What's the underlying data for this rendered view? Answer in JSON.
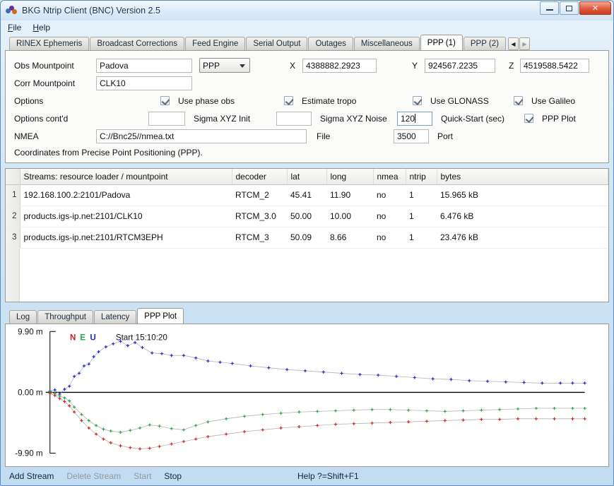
{
  "window": {
    "title": "BKG Ntrip Client (BNC) Version 2.5",
    "icon": "bnc-app-icon",
    "buttons": {
      "minimize": "minimize-icon",
      "maximize": "maximize-icon",
      "close": "✕"
    }
  },
  "menubar": {
    "items": [
      {
        "label": "File"
      },
      {
        "label": "Help"
      }
    ]
  },
  "top_tabs": {
    "items": [
      {
        "label": "RINEX Ephemeris",
        "active": false
      },
      {
        "label": "Broadcast Corrections",
        "active": false
      },
      {
        "label": "Feed Engine",
        "active": false
      },
      {
        "label": "Serial Output",
        "active": false
      },
      {
        "label": "Outages",
        "active": false
      },
      {
        "label": "Miscellaneous",
        "active": false
      },
      {
        "label": "PPP (1)",
        "active": true
      },
      {
        "label": "PPP (2)",
        "active": false
      }
    ],
    "scroll_left": "◀",
    "scroll_right": "▶"
  },
  "ppp_form": {
    "obs_mountpoint_label": "Obs Mountpoint",
    "obs_mountpoint_value": "Padova",
    "mode_combo_value": "PPP",
    "x_label": "X",
    "x_value": "4388882.2923",
    "y_label": "Y",
    "y_value": "924567.2235",
    "z_label": "Z",
    "z_value": "4519588.5422",
    "corr_mountpoint_label": "Corr Mountpoint",
    "corr_mountpoint_value": "CLK10",
    "options_label": "Options",
    "use_phase_obs_label": "Use phase obs",
    "use_phase_obs_checked": true,
    "estimate_tropo_label": "Estimate tropo",
    "estimate_tropo_checked": true,
    "use_glonass_label": "Use GLONASS",
    "use_glonass_checked": true,
    "use_galileo_label": "Use Galileo",
    "use_galileo_checked": true,
    "options_contd_label": "Options cont'd",
    "sigma_xyz_init_label": "Sigma XYZ Init",
    "sigma_xyz_init_value": "",
    "sigma_xyz_noise_label": "Sigma XYZ Noise",
    "sigma_xyz_noise_value": "120",
    "sigma_xyz_noise_focused": true,
    "quick_start_label": "Quick-Start (sec)",
    "ppp_plot_label": "PPP Plot",
    "ppp_plot_checked": true,
    "nmea_label": "NMEA",
    "nmea_value": "C://Bnc25//nmea.txt",
    "file_label": "File",
    "port_value": "3500",
    "port_label": "Port",
    "note": "Coordinates from Precise Point Positioning (PPP)."
  },
  "streams_table": {
    "columns": [
      {
        "key": "gutter",
        "label": ""
      },
      {
        "key": "resource",
        "label": "Streams:   resource loader / mountpoint"
      },
      {
        "key": "decoder",
        "label": "decoder"
      },
      {
        "key": "lat",
        "label": "lat"
      },
      {
        "key": "long",
        "label": "long"
      },
      {
        "key": "nmea",
        "label": "nmea"
      },
      {
        "key": "ntrip",
        "label": "ntrip"
      },
      {
        "key": "bytes",
        "label": "bytes"
      }
    ],
    "rows": [
      {
        "n": "1",
        "resource": "192.168.100.2:2101/Padova",
        "decoder": "RTCM_2",
        "lat": "45.41",
        "long": "11.90",
        "nmea": "no",
        "ntrip": "1",
        "bytes": "15.965 kB"
      },
      {
        "n": "2",
        "resource": "products.igs-ip.net:2101/CLK10",
        "decoder": "RTCM_3.0",
        "lat": "50.00",
        "long": "10.00",
        "nmea": "no",
        "ntrip": "1",
        "bytes": "6.476 kB"
      },
      {
        "n": "3",
        "resource": "products.igs-ip.net:2101/RTCM3EPH",
        "decoder": "RTCM_3",
        "lat": "50.09",
        "long": "8.66",
        "nmea": "no",
        "ntrip": "1",
        "bytes": "23.476 kB"
      }
    ]
  },
  "bottom_tabs": {
    "items": [
      {
        "label": "Log",
        "active": false
      },
      {
        "label": "Throughput",
        "active": false
      },
      {
        "label": "Latency",
        "active": false
      },
      {
        "label": "PPP Plot",
        "active": true
      }
    ]
  },
  "statusbar": {
    "add_stream": "Add Stream",
    "delete_stream": "Delete Stream",
    "start": "Start",
    "stop": "Stop",
    "help": "Help ?=Shift+F1",
    "add_stream_enabled": true,
    "delete_stream_enabled": false,
    "start_enabled": false,
    "stop_enabled": true
  },
  "chart_data": {
    "type": "scatter",
    "title": "",
    "start_label": "Start 15:10:20",
    "ylabel": "",
    "xlabel": "",
    "ylim": [
      -9.9,
      9.9
    ],
    "ytick_labels": [
      "9.90 m",
      "0.00 m",
      "-9.90 m"
    ],
    "yticks": [
      9.9,
      0.0,
      -9.9
    ],
    "grid": false,
    "zero_line": true,
    "legend_position": "top-left",
    "legend": [
      {
        "name": "N",
        "color": "#cc2222"
      },
      {
        "name": "E",
        "color": "#22aa44"
      },
      {
        "name": "U",
        "color": "#2222cc"
      }
    ],
    "series": [
      {
        "name": "U",
        "color": "#2222cc",
        "x": [
          0.0,
          0.4,
          0.8,
          1.2,
          1.6,
          2.0,
          2.4,
          2.8,
          3.2,
          3.6,
          4.0,
          4.6,
          5.2,
          5.8,
          6.4,
          7.0,
          7.6,
          8.4,
          9.2,
          10.0,
          11.0,
          12.0,
          13.0,
          14.0,
          15.0,
          16.5,
          18.0,
          19.5,
          21.0,
          22.5,
          24.0,
          25.5,
          27.0,
          28.5,
          30.0,
          31.5,
          33.0,
          34.5,
          36.0,
          37.5,
          39.0,
          40.5,
          42.0,
          43.0,
          44.0
        ],
        "y": [
          0.2,
          0.4,
          -0.3,
          0.5,
          1.0,
          2.6,
          3.1,
          4.3,
          4.6,
          5.8,
          6.6,
          7.4,
          7.9,
          8.3,
          7.6,
          8.1,
          7.3,
          6.4,
          6.3,
          6.0,
          6.0,
          5.6,
          5.1,
          4.9,
          4.7,
          4.3,
          4.0,
          3.7,
          3.5,
          3.3,
          3.1,
          2.9,
          2.8,
          2.6,
          2.4,
          2.2,
          2.1,
          1.9,
          1.8,
          1.7,
          1.6,
          1.5,
          1.5,
          1.5,
          1.5
        ]
      },
      {
        "name": "E",
        "color": "#22aa44",
        "x": [
          0.0,
          0.4,
          0.8,
          1.2,
          1.6,
          2.0,
          2.6,
          3.2,
          3.8,
          4.4,
          5.0,
          5.8,
          6.6,
          7.4,
          8.2,
          9.0,
          10.0,
          11.0,
          12.0,
          13.0,
          14.5,
          16.0,
          17.5,
          19.0,
          20.5,
          22.0,
          23.5,
          25.0,
          26.5,
          28.0,
          29.5,
          31.0,
          32.5,
          34.0,
          35.5,
          37.0,
          38.5,
          40.0,
          41.5,
          43.0,
          44.0
        ],
        "y": [
          0.1,
          -0.2,
          -0.6,
          -0.9,
          -1.4,
          -2.4,
          -3.6,
          -4.6,
          -5.4,
          -6.0,
          -6.3,
          -6.5,
          -6.2,
          -5.8,
          -5.3,
          -5.5,
          -5.9,
          -6.1,
          -5.4,
          -4.8,
          -4.3,
          -3.9,
          -3.6,
          -3.4,
          -3.2,
          -3.1,
          -3.0,
          -2.9,
          -2.8,
          -2.8,
          -2.9,
          -3.0,
          -3.1,
          -3.0,
          -2.9,
          -2.8,
          -2.7,
          -2.6,
          -2.6,
          -2.6,
          -2.6
        ]
      },
      {
        "name": "N",
        "color": "#cc2222",
        "x": [
          0.0,
          0.4,
          0.8,
          1.2,
          1.6,
          2.0,
          2.6,
          3.2,
          3.8,
          4.4,
          5.0,
          5.8,
          6.6,
          7.4,
          8.2,
          9.0,
          10.0,
          11.0,
          12.0,
          13.0,
          14.5,
          16.0,
          17.5,
          19.0,
          20.5,
          22.0,
          23.5,
          25.0,
          26.5,
          28.0,
          29.5,
          31.0,
          32.5,
          34.0,
          35.5,
          37.0,
          38.5,
          40.0,
          41.5,
          43.0,
          44.0
        ],
        "y": [
          -0.2,
          -0.5,
          -1.0,
          -1.5,
          -2.2,
          -3.2,
          -4.6,
          -5.8,
          -6.8,
          -7.6,
          -8.2,
          -8.7,
          -9.0,
          -9.2,
          -9.1,
          -8.8,
          -8.4,
          -8.0,
          -7.6,
          -7.2,
          -6.8,
          -6.4,
          -6.1,
          -5.8,
          -5.6,
          -5.4,
          -5.2,
          -5.1,
          -5.0,
          -4.9,
          -4.8,
          -4.7,
          -4.6,
          -4.5,
          -4.4,
          -4.4,
          -4.3,
          -4.3,
          -4.3,
          -4.3,
          -4.3
        ]
      }
    ]
  }
}
